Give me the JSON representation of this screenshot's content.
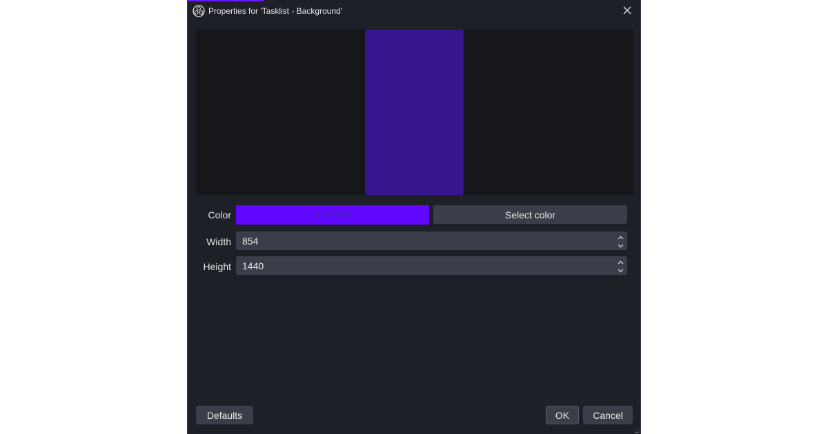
{
  "window": {
    "title": "Properties for 'Tasklist - Background'",
    "icons": {
      "app": "obs-logo-icon",
      "close": "close-icon"
    },
    "accent_color": "#6a1bff"
  },
  "preview": {
    "background": "#16171b",
    "fill_color": "#36158e"
  },
  "form": {
    "color": {
      "label": "Color",
      "value": "#ff6106ff",
      "swatch": "#6106ff",
      "button_label": "Select color"
    },
    "width": {
      "label": "Width",
      "value": "854"
    },
    "height": {
      "label": "Height",
      "value": "1440"
    }
  },
  "footer": {
    "defaults_label": "Defaults",
    "ok_label": "OK",
    "cancel_label": "Cancel"
  }
}
